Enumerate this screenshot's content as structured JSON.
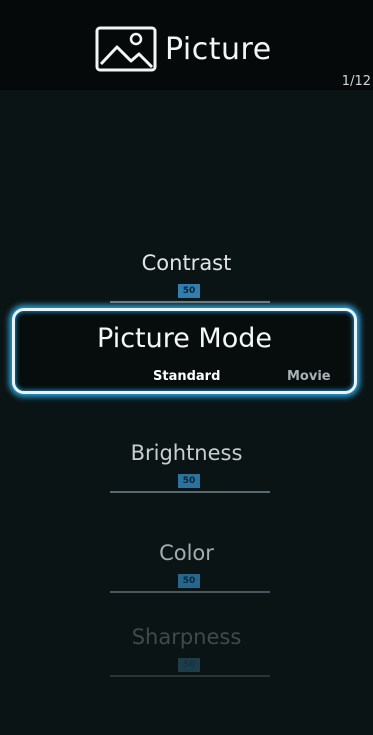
{
  "header": {
    "title": "Picture",
    "icon": "picture-icon",
    "page_indicator": "1/12"
  },
  "picture_mode": {
    "label": "Picture Mode",
    "current_value": "Standard",
    "next_value": "Movie"
  },
  "settings": [
    {
      "label": "Contrast",
      "value": "50"
    },
    {
      "label": "Brightness",
      "value": "50"
    },
    {
      "label": "Color",
      "value": "50"
    },
    {
      "label": "Sharpness",
      "value": "50"
    }
  ],
  "colors": {
    "focus_glow": "#2ea0d7",
    "slider_accent": "#3b8fc4"
  }
}
